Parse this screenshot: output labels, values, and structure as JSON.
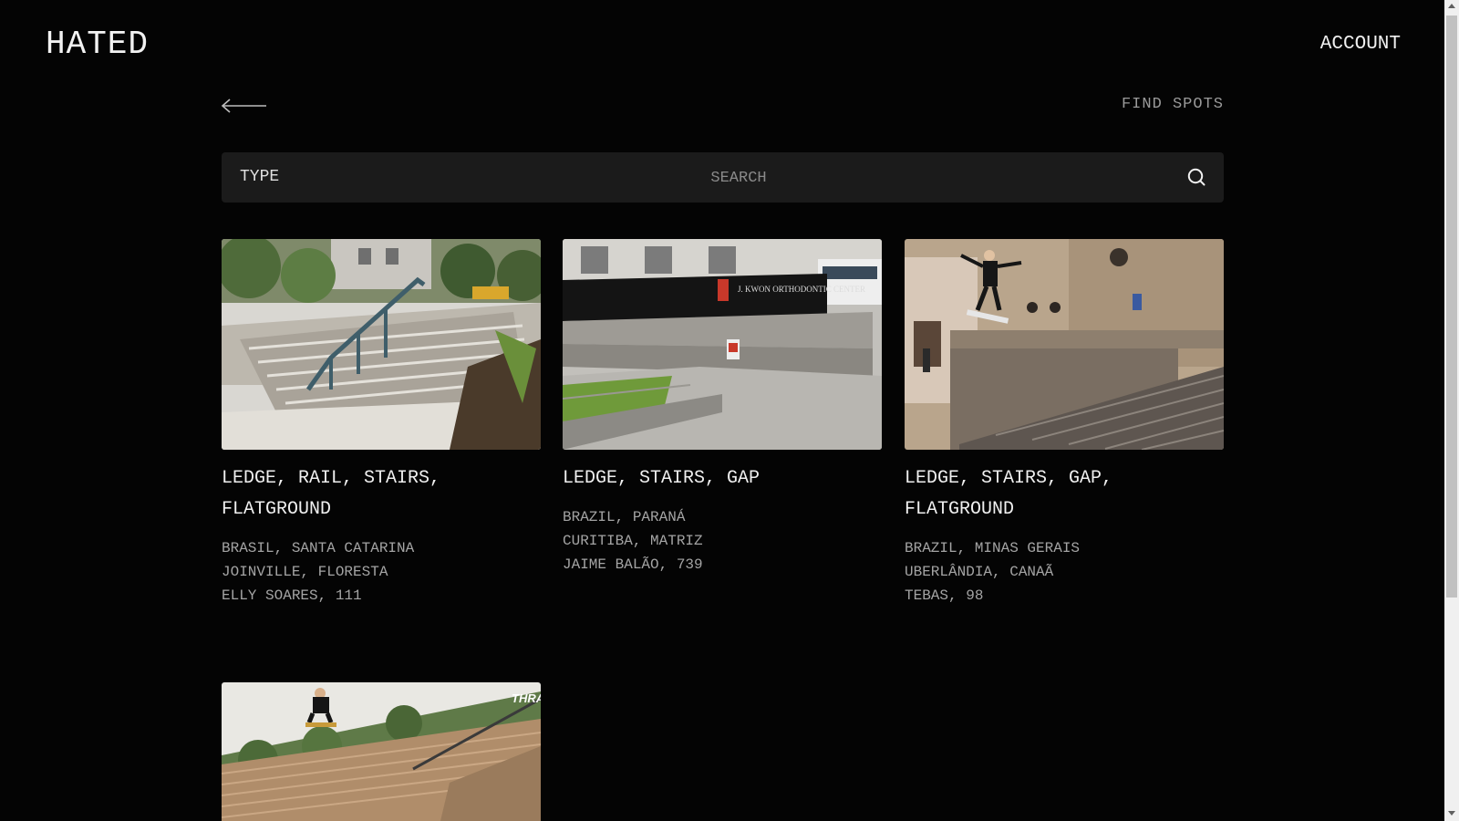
{
  "header": {
    "logo": "HATED",
    "account_label": "ACCOUNT"
  },
  "subnav": {
    "back_icon": "arrow-left-icon",
    "find_label": "FIND SPOTS"
  },
  "search": {
    "type_label": "TYPE",
    "placeholder": "SEARCH",
    "value": "",
    "search_icon": "search-icon"
  },
  "spots": [
    {
      "types": "LEDGE, RAIL, STAIRS, FLATGROUND",
      "line1": "BRASIL, SANTA CATARINA",
      "line2": "JOINVILLE, FLORESTA",
      "line3": "ELLY SOARES, 111"
    },
    {
      "types": "LEDGE, STAIRS, GAP",
      "line1": "BRAZIL, PARANÁ",
      "line2": "CURITIBA, MATRIZ",
      "line3": "JAIME BALÃO, 739"
    },
    {
      "types": "LEDGE, STAIRS, GAP, FLATGROUND",
      "line1": "BRAZIL, MINAS GERAIS",
      "line2": "UBERLÂNDIA, CANAÃ",
      "line3": "TEBAS, 98"
    },
    {
      "types": "",
      "line1": "",
      "line2": "",
      "line3": ""
    }
  ],
  "photo_texts": {
    "sign": "J. KWON ORTHODONTIC CENTER",
    "logo": "THRAS"
  },
  "colors": {
    "background": "#040404",
    "search_bg": "#1b1b1b",
    "muted_text": "#a4a4a4"
  }
}
